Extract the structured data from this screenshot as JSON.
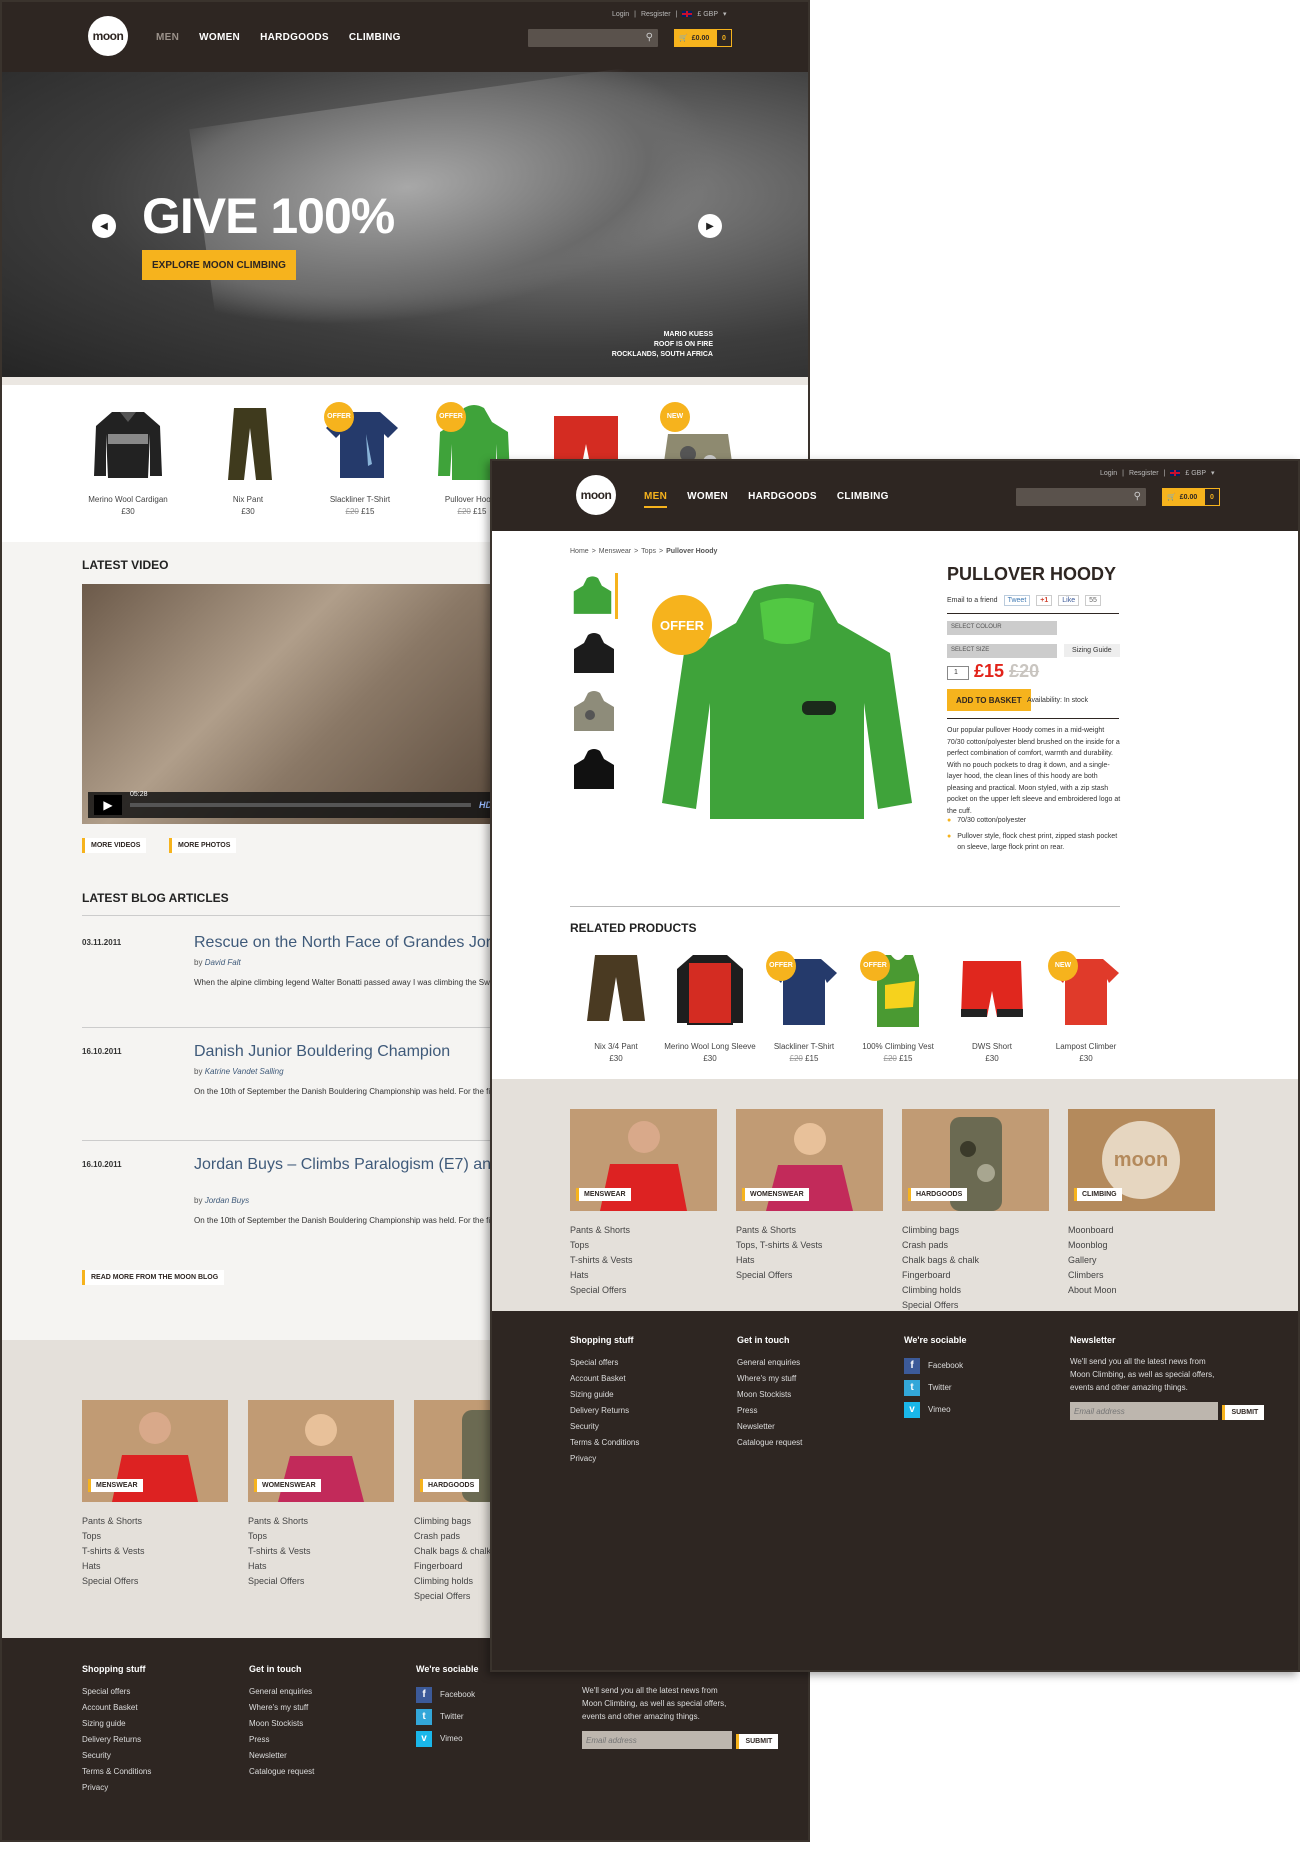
{
  "header": {
    "logo": "moon",
    "nav": [
      "MEN",
      "WOMEN",
      "HARDGOODS",
      "CLIMBING"
    ],
    "login": "Login",
    "register": "Resgister",
    "currency": "£ GBP",
    "cart_total": "£0.00",
    "cart_count": "0"
  },
  "hero": {
    "headline": "GIVE 100%",
    "cta": "EXPLORE MOON CLIMBING",
    "credit": [
      "MARIO KUESS",
      "ROOF IS ON FIRE",
      "ROCKLANDS, SOUTH AFRICA"
    ]
  },
  "home_products": [
    {
      "name": "Merino Wool Cardigan",
      "price": "£30",
      "old": "",
      "badge": ""
    },
    {
      "name": "Nix Pant",
      "price": "£30",
      "old": "",
      "badge": ""
    },
    {
      "name": "Slackliner T-Shirt",
      "price": "£15",
      "old": "£20",
      "badge": "OFFER"
    },
    {
      "name": "Pullover Hoody",
      "price": "£15",
      "old": "£20",
      "badge": "OFFER"
    },
    {
      "name": "",
      "price": "",
      "old": "",
      "badge": ""
    },
    {
      "name": "",
      "price": "",
      "old": "",
      "badge": "NEW"
    }
  ],
  "video": {
    "heading": "LATEST VIDEO",
    "time": "05:28",
    "hd": "HD",
    "more_videos": "MORE VIDEOS",
    "more_photos": "MORE PHOTOS"
  },
  "blog": {
    "heading": "LATEST BLOG ARTICLES",
    "articles": [
      {
        "date": "03.11.2011",
        "title": "Rescue on the North Face of Grandes Jorasses",
        "by": "by",
        "author": "David Falt",
        "excerpt": "When the alpine climbing legend Walter Bonatti passed away I was climbing the Swiss route on Cima Ovest with Helen and one thought that popped up in my head..."
      },
      {
        "date": "16.10.2011",
        "title": "Danish Junior Bouldering Champion",
        "by": "by",
        "author": "Katrine Vandet Salling",
        "excerpt": "On the 10th of September the Danish Bouldering Championship was held. For the first time in years the competition was located in the city I live in and therefore..."
      },
      {
        "date": "16.10.2011",
        "title": "Jordan Buys – Climbs Paralogism (E7) and The Keswickian (E8)",
        "by": "by",
        "author": "Jordan Buys",
        "excerpt": "On the 10th of September the Danish Bouldering Championship was held. For the first time in years the competition was located in the city I live in"
      }
    ],
    "read_more": "READ MORE FROM THE MOON BLOG"
  },
  "categories": [
    {
      "label": "MENSWEAR",
      "links": [
        "Pants & Shorts",
        "Tops",
        "T-shirts & Vests",
        "Hats",
        "Special Offers"
      ]
    },
    {
      "label": "WOMENSWEAR",
      "links": [
        "Pants & Shorts",
        "Tops, T-shirts & Vests",
        "Hats",
        "Special Offers"
      ]
    },
    {
      "label": "HARDGOODS",
      "links": [
        "Climbing bags",
        "Crash pads",
        "Chalk bags & chalk",
        "Fingerboard",
        "Climbing holds",
        "Special Offers"
      ]
    },
    {
      "label": "CLIMBING",
      "links": [
        "Moonboard",
        "Moonblog",
        "Gallery",
        "Climbers",
        "About Moon"
      ]
    }
  ],
  "home_categories": [
    {
      "label": "MENSWEAR",
      "links": [
        "Pants & Shorts",
        "Tops",
        "T-shirts & Vests",
        "Hats",
        "Special Offers"
      ]
    },
    {
      "label": "WOMENSWEAR",
      "links": [
        "Pants & Shorts",
        "Tops",
        "T-shirts & Vests",
        "Hats",
        "Special Offers"
      ]
    },
    {
      "label": "HARDGOODS",
      "links": [
        "Climbing bags",
        "Crash pads",
        "Chalk bags & chalk",
        "Fingerboard",
        "Climbing holds",
        "Special Offers"
      ]
    }
  ],
  "footer": {
    "shopping": {
      "title": "Shopping stuff",
      "links": [
        "Special offers",
        "Account Basket",
        "Sizing guide",
        "Delivery Returns",
        "Security",
        "Terms & Conditions",
        "Privacy"
      ]
    },
    "contact": {
      "title": "Get in touch",
      "links": [
        "General enquiries",
        "Where's my stuff",
        "Moon Stockists",
        "Press",
        "Newsletter",
        "Catalogue request"
      ]
    },
    "social": {
      "title": "We're sociable",
      "links": [
        "Facebook",
        "Twitter",
        "Vimeo"
      ]
    },
    "newsletter": {
      "title": "Newsletter",
      "text": "We'll send you all the latest news from Moon Climbing, as well as special offers, events and other amazing things.",
      "placeholder": "Email address",
      "submit": "SUBMIT"
    }
  },
  "product": {
    "breadcrumb": [
      "Home",
      "Menswear",
      "Tops"
    ],
    "breadcrumb_current": "Pullover Hoody",
    "sep": ">",
    "title": "PULLOVER HOODY",
    "email_friend": "Email to a friend",
    "tweet": "Tweet",
    "plus": "+1",
    "like": "Like",
    "like_count": "55",
    "select_colour": "SELECT COLOUR",
    "select_size": "SELECT SIZE",
    "sizing_guide": "Sizing Guide",
    "qty": "1",
    "price": "£15",
    "old_price": "£20",
    "add_to_basket": "ADD TO BASKET",
    "availability": "Availability: In stock",
    "offer": "OFFER",
    "description": "Our popular pullover Hoody comes in a mid-weight 70/30 cotton/polyester blend brushed on the inside for a perfect combination of comfort, warmth and durability. With no pouch pockets to drag it down, and a single-layer hood, the clean lines of this hoody are both pleasing and practical. Moon styled, with a zip stash pocket on the upper left sleeve and embroidered logo at the cuff.",
    "bullets": [
      "70/30 cotton/polyester",
      "Pullover style, flock chest print, zipped stash pocket on sleeve, large flock print on rear."
    ],
    "related_heading": "RELATED PRODUCTS",
    "related": [
      {
        "name": "Nix 3/4 Pant",
        "price": "£30",
        "old": "",
        "badge": ""
      },
      {
        "name": "Merino Wool Long Sleeve",
        "price": "£30",
        "old": "",
        "badge": ""
      },
      {
        "name": "Slackliner T-Shirt",
        "price": "£15",
        "old": "£20",
        "badge": "OFFER"
      },
      {
        "name": "100% Climbing Vest",
        "price": "£15",
        "old": "£20",
        "badge": "OFFER"
      },
      {
        "name": "DWS Short",
        "price": "£30",
        "old": "",
        "badge": ""
      },
      {
        "name": "Lampost Climber",
        "price": "£30",
        "old": "",
        "badge": "NEW"
      }
    ]
  },
  "colors": {
    "brand_dark": "#2e2622",
    "accent": "#f6b31d",
    "price_red": "#e2231a",
    "link_blue": "#3f5a7a"
  }
}
